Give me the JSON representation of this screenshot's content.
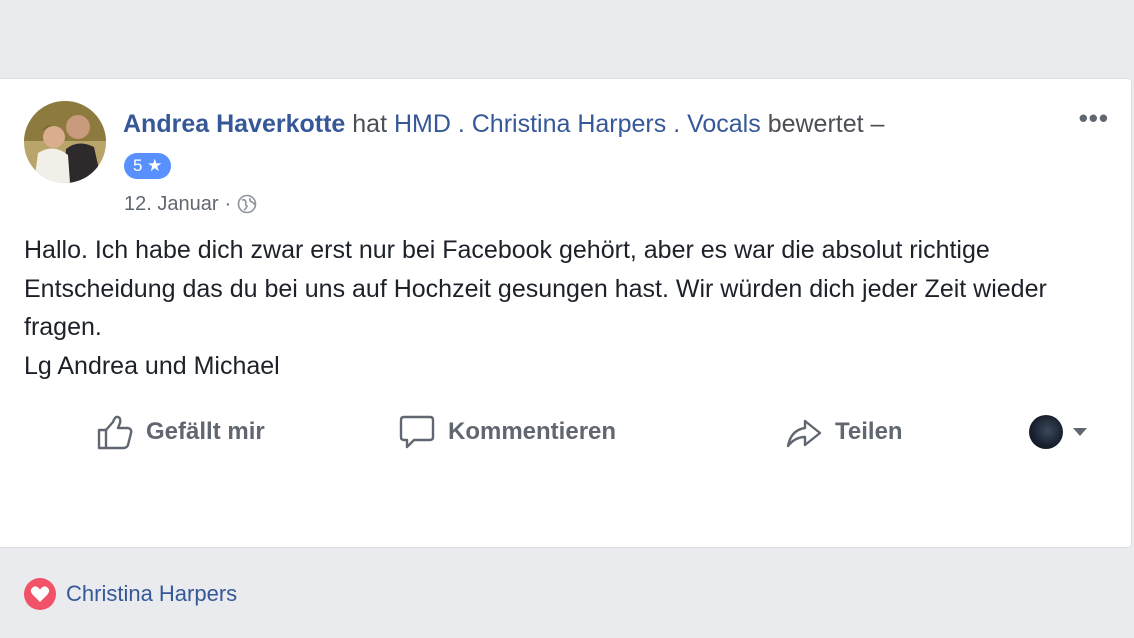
{
  "post": {
    "author": "Andrea Haverkotte",
    "action_text": " hat ",
    "page_name": "HMD . Christina Harpers . Vocals",
    "suffix": " bewertet –",
    "rating": "5 ★",
    "date": "12. Januar",
    "separator": "·",
    "more": "•••",
    "body": "Hallo. Ich habe dich zwar erst nur bei Facebook gehört, aber es war die absolut richtige Entscheidung das du bei uns auf Hochzeit gesungen hast. Wir würden dich jeder Zeit wieder fragen.\nLg Andrea und Michael"
  },
  "actions": {
    "like": "Gefällt mir",
    "comment": "Kommentieren",
    "share": "Teilen"
  },
  "reaction": {
    "name": "Christina Harpers",
    "icon": "heart-icon",
    "color": "#f25268"
  },
  "colors": {
    "link": "#365899",
    "badge": "#5890ff",
    "background": "#e9ebee"
  }
}
